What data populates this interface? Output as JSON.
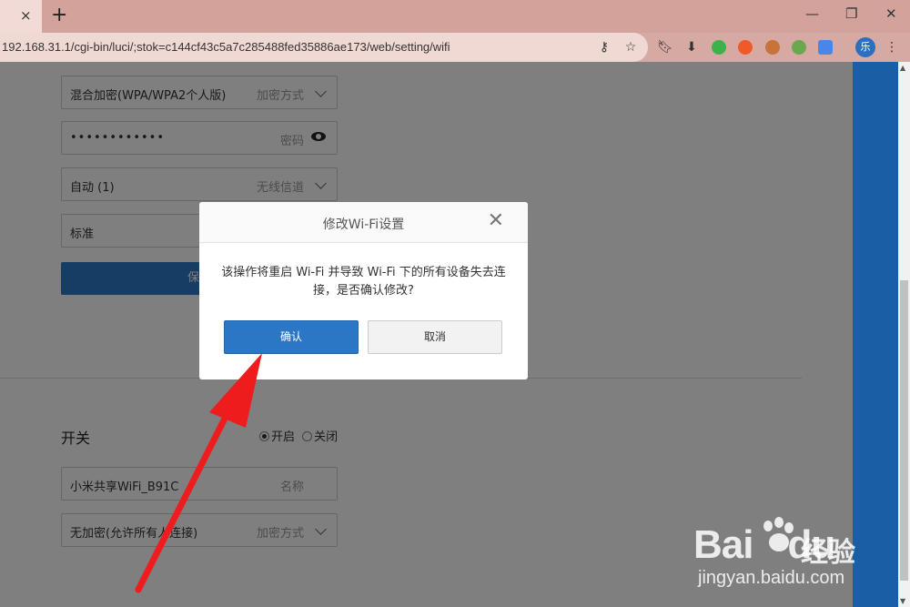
{
  "browser": {
    "tab_close": "×",
    "new_tab": "+",
    "win_min": "—",
    "win_restore": "❐",
    "win_close": "✕",
    "url": "192.168.31.1/cgi-bin/luci/;stok=c144cf43c5a7c285488fed35886ae173/web/setting/wifi",
    "avatar_text": "乐"
  },
  "form": {
    "encryption_value": "混合加密(WPA/WPA2个人版)",
    "encryption_placeholder": "加密方式",
    "password_value": "••••••••••••",
    "password_placeholder": "密码",
    "channel_value": "自动 (1)",
    "channel_placeholder": "无线信道",
    "strength_value": "标准",
    "save_label": "保存",
    "switch_label": "开关",
    "radio_on": "开启",
    "radio_off": "关闭",
    "guest_name_value": "小米共享WiFi_B91C",
    "guest_name_placeholder": "名称",
    "guest_enc_value": "无加密(允许所有人连接)",
    "guest_enc_placeholder": "加密方式"
  },
  "modal": {
    "title": "修改Wi-Fi设置",
    "close": "✕",
    "message": "该操作将重启 Wi-Fi 并导致 Wi-Fi 下的所有设备失去连接，是否确认修改?",
    "ok_label": "确认",
    "cancel_label": "取消"
  },
  "watermark": {
    "logo": "Bai",
    "logo_tail": "du",
    "cn": "经验",
    "url": "jingyan.baidu.com"
  },
  "colors": {
    "arrow": "#ee1c1c",
    "primary": "#2b77c5"
  }
}
